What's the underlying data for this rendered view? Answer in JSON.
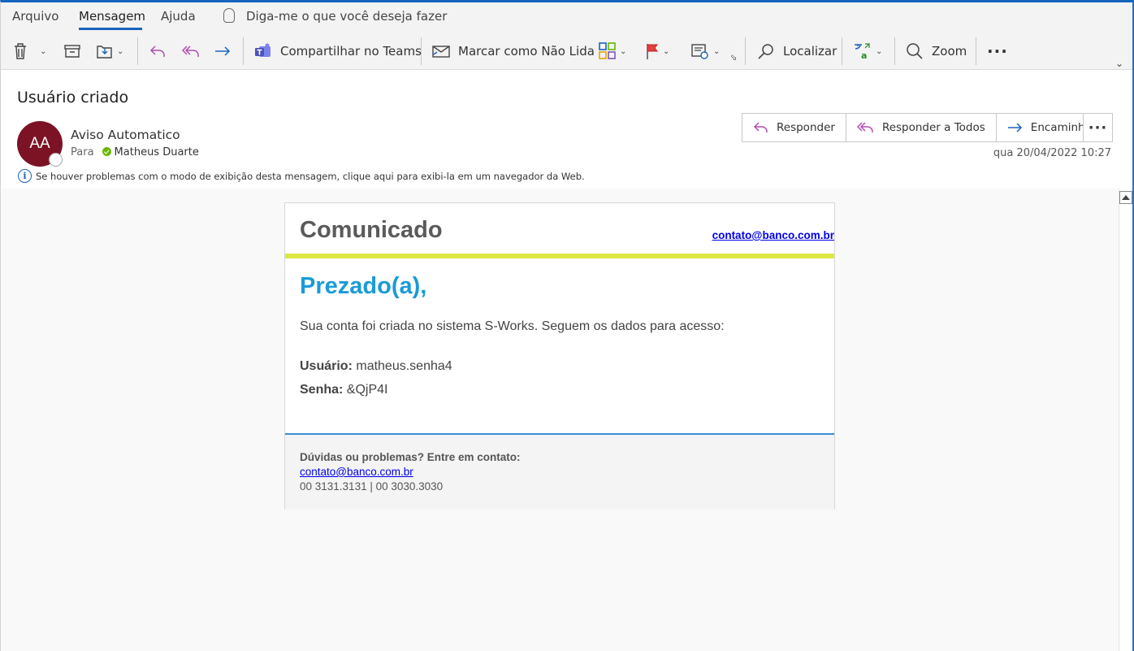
{
  "ribbon": {
    "tabs": [
      "Arquivo",
      "Mensagem",
      "Ajuda"
    ],
    "tell_me": "Diga-me o que você deseja fazer",
    "share_teams": "Compartilhar no Teams",
    "mark_unread": "Marcar como Não Lida",
    "find": "Localizar",
    "zoom": "Zoom",
    "icons": [
      "delete-icon",
      "archive-icon",
      "move-icon",
      "reply-icon",
      "reply-all-icon",
      "forward-icon",
      "teams-icon",
      "mark-unread-icon",
      "categorize-icon",
      "flag-icon",
      "policy-icon",
      "search-icon",
      "translate-icon",
      "zoom-icon",
      "more-icon"
    ]
  },
  "message": {
    "subject": "Usuário criado",
    "avatar_initials": "AA",
    "avatar_color": "#7b1325",
    "sender": "Aviso Automatico",
    "to_label": "Para",
    "recipient": "Matheus Duarte",
    "info_bar": "Se houver problemas com o modo de exibição desta mensagem, clique aqui para exibi-la em um navegador da Web.",
    "date": "qua 20/04/2022 10:27",
    "actions": {
      "reply": "Responder",
      "reply_all": "Responder a Todos",
      "forward": "Encaminhar"
    }
  },
  "email": {
    "title": "Comunicado",
    "header_link": "contato@banco.com.br",
    "greeting": "Prezado(a),",
    "body": "Sua conta foi criada no sistema S-Works. Seguem os dados para acesso:",
    "user_label": "Usuário:",
    "user_value": "matheus.senha4",
    "pass_label": "Senha:",
    "pass_value": "&QjP4I",
    "footer_question": "Dúvidas ou problemas? Entre em contato:",
    "footer_link": "contato@banco.com.br",
    "footer_phones": "00 3131.3131 | 00 3030.3030",
    "accent_yellow": "#dde940",
    "accent_blue": "#1a9bd7"
  }
}
